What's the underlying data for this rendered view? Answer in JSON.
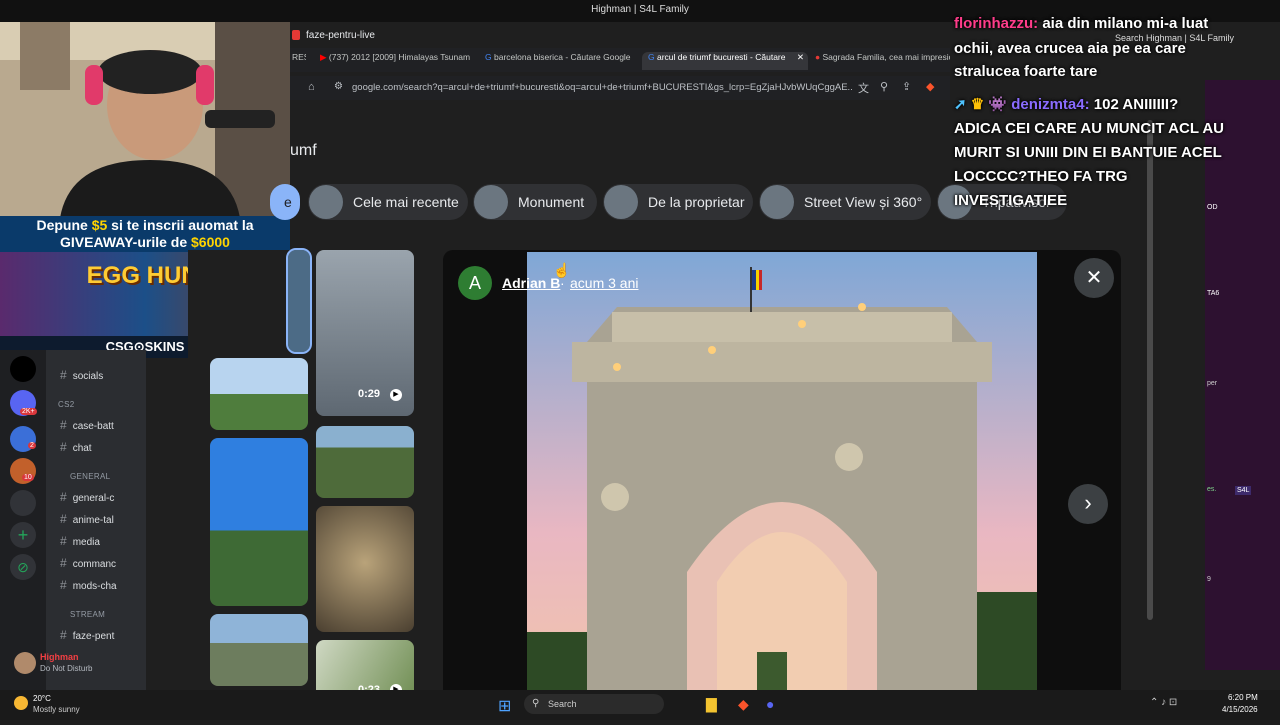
{
  "window": {
    "title": "Highman | S4L Family"
  },
  "bookmarks": {
    "folder": "faze-pentru-live"
  },
  "tabs": [
    {
      "label": "(737) 2012 [2009] Himalayas Tsunami",
      "active": false
    },
    {
      "label": "barcelona biserica - Căutare Google",
      "active": false
    },
    {
      "label": "arcul de triumf bucuresti - Căutare",
      "active": true
    },
    {
      "label": "Sagrada Familia, cea mai impresionantă",
      "active": false
    }
  ],
  "address": {
    "url": "google.com/search?q=arcul+de+triumf+bucuresti&oq=arcul+de+triumf+BUCURESTI&gs_lcrp=EgZjaHJvbWUqCggAE..."
  },
  "search": {
    "query_tail": "umf"
  },
  "chips": [
    {
      "label": "e"
    },
    {
      "label": "Cele mai recente"
    },
    {
      "label": "Monument"
    },
    {
      "label": "De la proprietar"
    },
    {
      "label": "Street View și 360°"
    },
    {
      "label": "Tripadvisor"
    }
  ],
  "thumbs": {
    "video1_duration": "0:29",
    "video2_duration": "0:23"
  },
  "viewer": {
    "avatar_letter": "A",
    "author": "Adrian B",
    "separator": "·",
    "age": "acum 3 ani"
  },
  "chat": {
    "lines": [
      {
        "user": "florinhazzu:",
        "text": " aia din milano mi-a luat"
      },
      {
        "text": "ochii, avea crucea aia pe ea care"
      },
      {
        "text": "stralucea foarte tare"
      },
      {
        "user": "denizmta4:",
        "text": " 102 ANIIIIII?"
      },
      {
        "text": "ADICA CEI CARE AU MUNCIT ACL AU"
      },
      {
        "text": "MURIT SI UNIII DIN EI BANTUIE ACEL"
      },
      {
        "text": "LOCCCC?THEO FA TRG"
      },
      {
        "text": "INVESTIGATIEE"
      }
    ],
    "user_colors": {
      "florinhazzu": "#ff3d8b",
      "denizmta4": "#8a6cff"
    }
  },
  "stream_window": {
    "search_placeholder": "Search Highman | S4L Family"
  },
  "promo": {
    "line1_pre": "Depune ",
    "line1_amount": "$5",
    "line1_post": " si te inscrii auomat la",
    "line2_pre": "GIVEAWAY-urile de ",
    "line2_amount": "$6000",
    "event": "EGG HUNT",
    "brand": "CSG⊙SKINS"
  },
  "discord": {
    "channels": [
      {
        "name": "socials"
      },
      {
        "category": "CS2"
      },
      {
        "name": "case-batt"
      },
      {
        "name": "chat"
      },
      {
        "category": "GENERAL"
      },
      {
        "name": "general-c"
      },
      {
        "name": "anime-tal"
      },
      {
        "name": "media"
      },
      {
        "name": "commanc"
      },
      {
        "name": "mods-cha"
      },
      {
        "category": "STREAM"
      },
      {
        "name": "faze-pent"
      }
    ],
    "server_badges": [
      "2K+",
      "2",
      "10"
    ],
    "user": {
      "name": "Highman",
      "status": "Do Not Disturb"
    }
  },
  "rightbar": {
    "items": [
      "OD",
      "TA6",
      "per",
      "es.",
      "S4L",
      "9"
    ]
  },
  "taskbar": {
    "weather_temp": "20°C",
    "weather_desc": "Mostly sunny",
    "search_label": "Search",
    "time": "6:20 PM",
    "date": "4/15/2026"
  },
  "colors": {
    "accent_green": "#2e7d32",
    "link": "#ffffff",
    "chip_bg": "#303134"
  }
}
